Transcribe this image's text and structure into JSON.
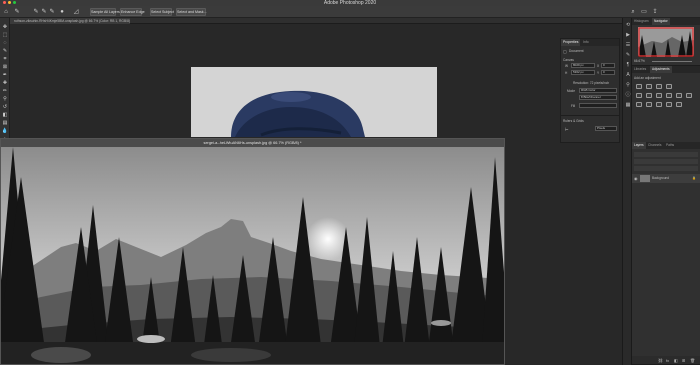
{
  "app": {
    "title": "Adobe Photoshop 2020"
  },
  "options_bar": {
    "sample_all_layers": "Sample All Layers",
    "enhance_edge": "Enhance Edge",
    "select_subject": "Select Subject",
    "select_and_mask": "Select and Mask..."
  },
  "tabs": {
    "back_doc": "ruthson-ziksuhin-RHsH4Kmje5BM-unsplash.jpg @ 66.7% (Color: RB 1, RGB/8)"
  },
  "front_doc": {
    "title": "sergei-a--heLWtuAN6Hs-unsplash.jpg @ 66.7% (RGB/8) *"
  },
  "properties": {
    "tabs": [
      "Properties",
      "Info"
    ],
    "doc_label": "Document",
    "canvas_label": "Canvas",
    "width": "8029 px",
    "height": "5362 px",
    "x": "0",
    "y": "0",
    "resolution": "Resolution: 72 pixels/inch",
    "mode_label": "Mode",
    "mode_value": "RGB Color",
    "depth_value": "8 Bits/Channel",
    "fill_label": "Fill",
    "rulers_label": "Rulers & Grids",
    "units_value": "Pixels"
  },
  "right_panels": {
    "top_tabs": [
      "Histogram",
      "Navigator"
    ],
    "zoom": "66.67%",
    "mid_tabs": [
      "Libraries",
      "Adjustments"
    ],
    "add_adjustment": "Add an adjustment",
    "layer_tabs": [
      "Layers",
      "Channels",
      "Paths"
    ],
    "layer_name": "Background"
  }
}
